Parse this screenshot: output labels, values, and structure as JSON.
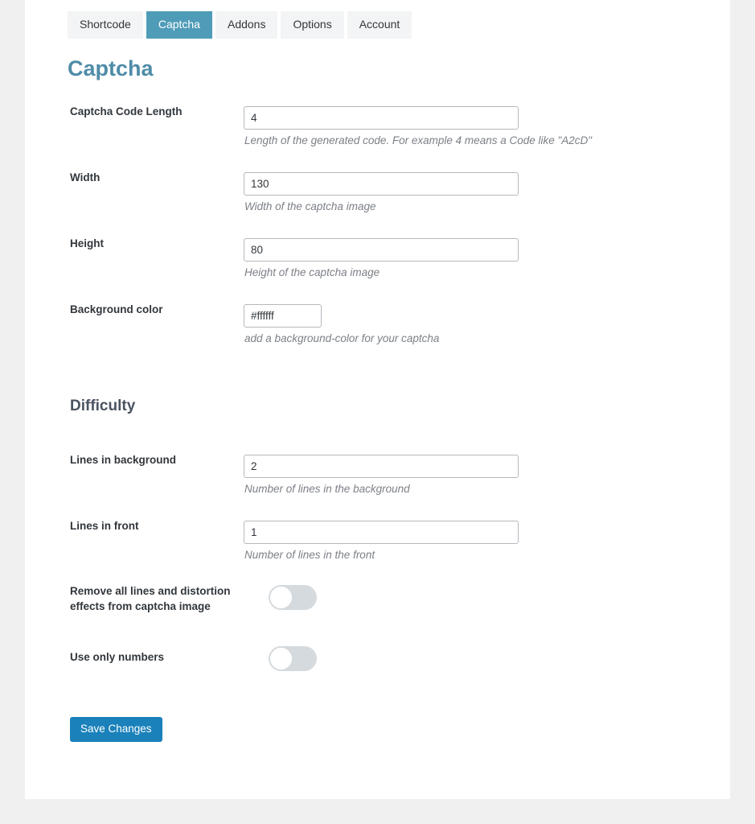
{
  "tabs": [
    {
      "label": "Shortcode",
      "active": false
    },
    {
      "label": "Captcha",
      "active": true
    },
    {
      "label": "Addons",
      "active": false
    },
    {
      "label": "Options",
      "active": false
    },
    {
      "label": "Account",
      "active": false
    }
  ],
  "page_title": "Captcha",
  "fields": {
    "code_length": {
      "label": "Captcha Code Length",
      "value": "4",
      "description": "Length of the generated code. For example 4 means a Code like \"A2cD\""
    },
    "width": {
      "label": "Width",
      "value": "130",
      "description": "Width of the captcha image"
    },
    "height": {
      "label": "Height",
      "value": "80",
      "description": "Height of the captcha image"
    },
    "background_color": {
      "label": "Background color",
      "value": "#ffffff",
      "description": "add a background-color for your captcha"
    },
    "lines_background": {
      "label": "Lines in background",
      "value": "2",
      "description": "Number of lines in the background"
    },
    "lines_front": {
      "label": "Lines in front",
      "value": "1",
      "description": "Number of lines in the front"
    },
    "remove_lines": {
      "label": "Remove all lines and distortion effects from captcha image",
      "state": "off"
    },
    "only_numbers": {
      "label": "Use only numbers",
      "state": "off"
    }
  },
  "sections": {
    "difficulty": "Difficulty"
  },
  "save_button": "Save Changes",
  "colors": {
    "accent_tab": "#4f9cb8",
    "title": "#4f8ca8",
    "save_button": "#1b81ba",
    "toggle_track": "#d5dade",
    "page_background": "#f0f0f0"
  }
}
